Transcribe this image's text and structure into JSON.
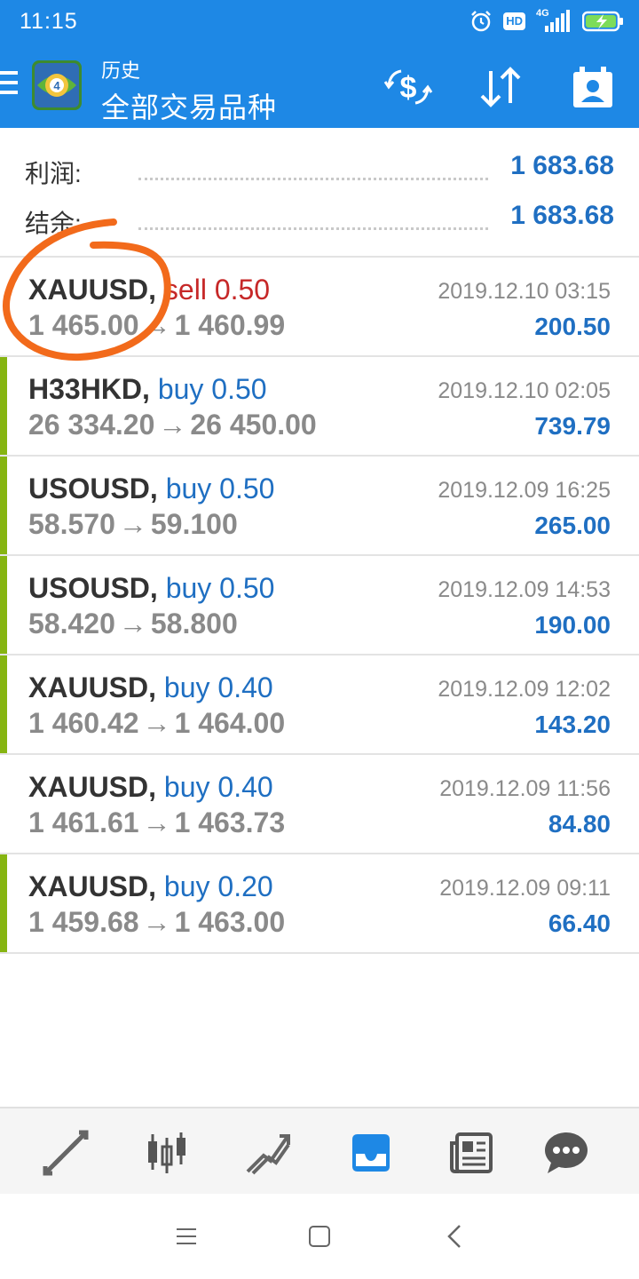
{
  "status_bar": {
    "time": "11:15",
    "hd_badge": "HD",
    "network": "4G",
    "icons": [
      "alarm-icon",
      "hd-icon",
      "signal-icon",
      "battery-charging-icon"
    ]
  },
  "app_bar": {
    "title": "历史",
    "subtitle": "全部交易品种",
    "icons": [
      "menu-icon",
      "currency-exchange-icon",
      "sort-icon",
      "account-icon"
    ]
  },
  "summary": {
    "profit_label": "利润:",
    "profit_value": "1 683.68",
    "balance_label": "结余:",
    "balance_value": "1 683.68"
  },
  "trades": [
    {
      "symbol": "XAUUSD,",
      "side": "sell 0.50",
      "open": "1 465.00",
      "close": "1 460.99",
      "time": "2019.12.10 03:15",
      "profit": "200.50"
    },
    {
      "symbol": "H33HKD,",
      "side": "buy 0.50",
      "open": "26 334.20",
      "close": "26 450.00",
      "time": "2019.12.10 02:05",
      "profit": "739.79"
    },
    {
      "symbol": "USOUSD,",
      "side": "buy 0.50",
      "open": "58.570",
      "close": "59.100",
      "time": "2019.12.09 16:25",
      "profit": "265.00"
    },
    {
      "symbol": "USOUSD,",
      "side": "buy 0.50",
      "open": "58.420",
      "close": "58.800",
      "time": "2019.12.09 14:53",
      "profit": "190.00"
    },
    {
      "symbol": "XAUUSD,",
      "side": "buy 0.40",
      "open": "1 460.42",
      "close": "1 464.00",
      "time": "2019.12.09 12:02",
      "profit": "143.20"
    },
    {
      "symbol": "XAUUSD,",
      "side": "buy 0.40",
      "open": "1 461.61",
      "close": "1 463.73",
      "time": "2019.12.09 11:56",
      "profit": "84.80"
    },
    {
      "symbol": "XAUUSD,",
      "side": "buy 0.20",
      "open": "1 459.68",
      "close": "1 463.00",
      "time": "2019.12.09 09:11",
      "profit": "66.40"
    }
  ],
  "arrow_glyph": "→",
  "tab_bar": {
    "tabs": [
      "quotes-icon",
      "chart-icon",
      "trade-icon",
      "history-icon",
      "news-icon",
      "chat-icon"
    ],
    "active": "history-icon"
  },
  "nav_bar": {
    "buttons": [
      "menu-nav-icon",
      "home-nav-icon",
      "back-nav-icon"
    ]
  },
  "colors": {
    "primary": "#1e88e5",
    "profit_blue": "#1f6fc2",
    "sell_red": "#c62828",
    "buy_marker": "#86b512",
    "annotation_orange": "#f26a1b"
  }
}
